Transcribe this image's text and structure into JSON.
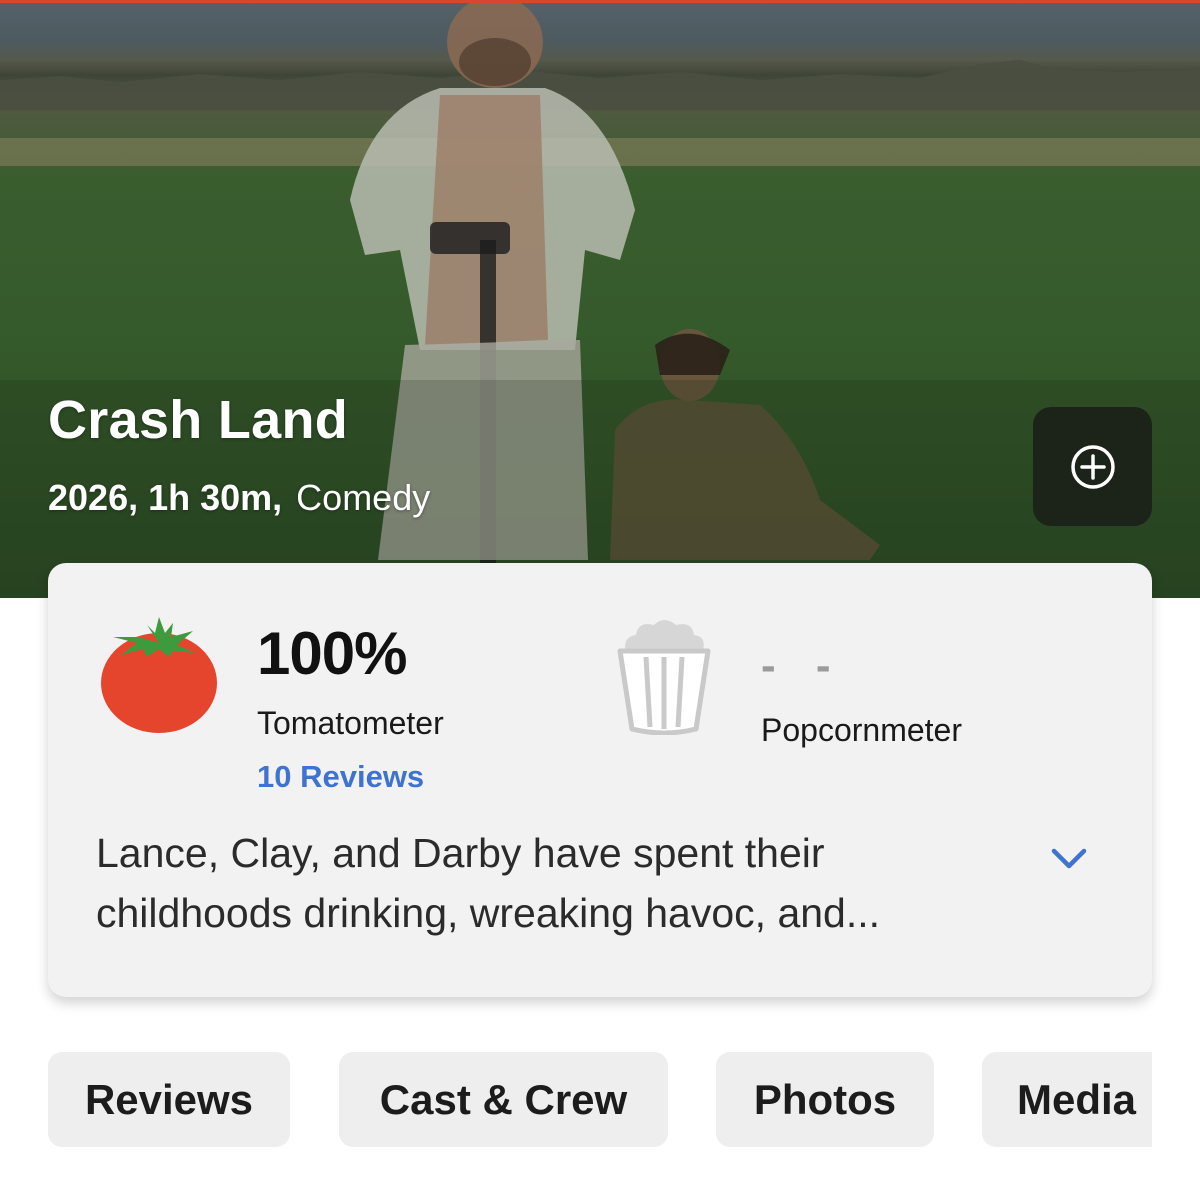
{
  "movie": {
    "title": "Crash Land",
    "year_runtime": "2026, 1h 30m,",
    "genre": "Comedy"
  },
  "actions": {
    "add_icon": "plus-circle-icon"
  },
  "scores": {
    "tomatometer": {
      "value": "100%",
      "label": "Tomatometer",
      "reviews_link": "10 Reviews",
      "icon": "tomato-icon"
    },
    "popcornmeter": {
      "value": "- -",
      "label": "Popcornmeter",
      "icon": "popcorn-bucket-icon"
    }
  },
  "synopsis": {
    "text": "Lance, Clay, and Darby have spent their childhoods drinking, wreaking havoc, and...",
    "expand_icon": "chevron-down-icon"
  },
  "tabs": [
    {
      "label": "Reviews"
    },
    {
      "label": "Cast & Crew"
    },
    {
      "label": "Photos"
    },
    {
      "label": "Media"
    }
  ],
  "colors": {
    "accent_top_line": "#d9452f",
    "link_blue": "#3f73d1",
    "tomato_red": "#e5452d",
    "tomato_green": "#3d9b3e",
    "card_bg": "#f2f2f2",
    "tab_bg": "#eeeeee"
  }
}
